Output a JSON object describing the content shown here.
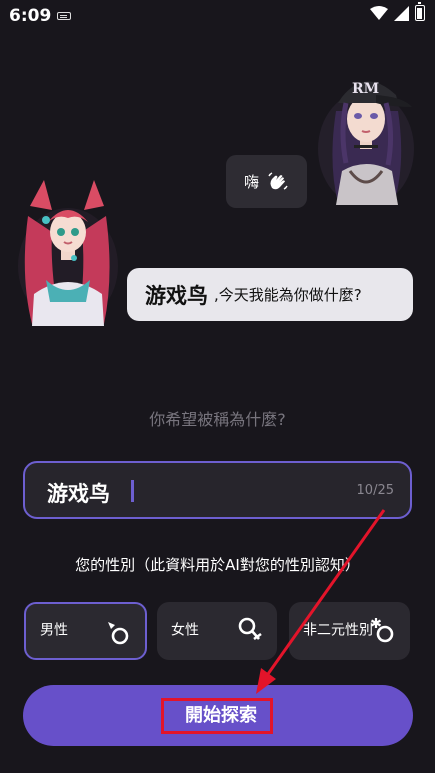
{
  "status_bar": {
    "time": "6:09"
  },
  "chat": {
    "greeting": "嗨",
    "bot_name": "游戏鸟",
    "bot_question": ",今天我能為你做什麼?"
  },
  "prompt": "你希望被稱為什麼?",
  "name_field": {
    "value": "游戏鸟",
    "counter": "10/25"
  },
  "gender": {
    "label": "您的性別（此資料用於AI對您的性別認知）",
    "options": [
      {
        "label": "男性",
        "selected": true
      },
      {
        "label": "女性",
        "selected": false
      },
      {
        "label": "非二元性別",
        "selected": false
      }
    ]
  },
  "explore_button": "開始探索",
  "colors": {
    "accent": "#6d5fd0",
    "button": "#6750c9",
    "annotation": "#e3142a",
    "background": "#18161c"
  }
}
